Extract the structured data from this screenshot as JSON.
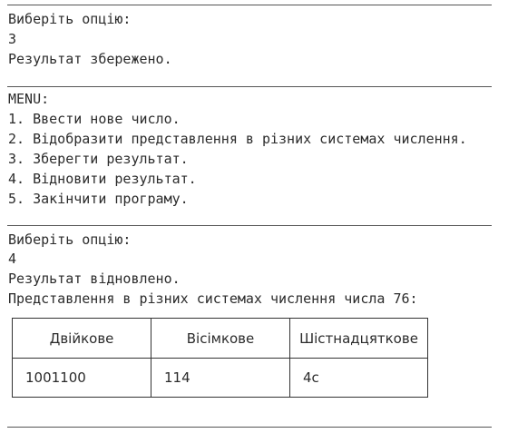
{
  "console": {
    "block1": {
      "prompt": "Виберіть опцію:",
      "input": "3",
      "message": "Результат збережено."
    },
    "menu": {
      "title": "MENU:",
      "items": [
        "1. Ввести нове число.",
        "2. Відобразити представлення в різних системах числення.",
        "3. Зберегти результат.",
        "4. Відновити результат.",
        "5. Закінчити програму."
      ]
    },
    "block2": {
      "prompt": "Виберіть опцію:",
      "input": "4",
      "message": "Результат відновлено.",
      "representation_caption": "Представлення в різних системах числення числа 76:"
    },
    "table": {
      "headers": [
        "Двійкове",
        "Вісімкове",
        "Шістнадцяткове"
      ],
      "rows": [
        [
          "1001100",
          "114",
          "4c"
        ]
      ]
    }
  }
}
